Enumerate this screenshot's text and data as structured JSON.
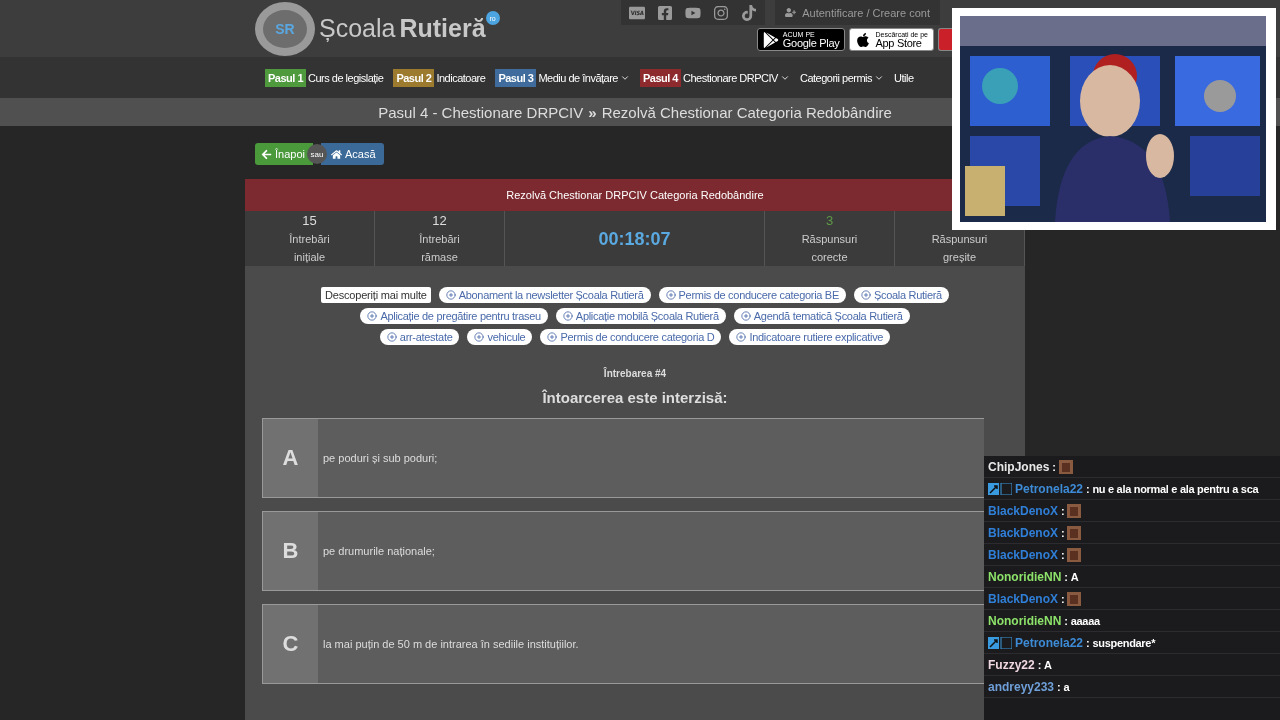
{
  "header": {
    "logo": {
      "mark": "SR",
      "name": "Școala",
      "name_bold": "Rutieră",
      "tld": "ro"
    },
    "login": "Autentificare / Creare cont",
    "stores": [
      {
        "kind": "google",
        "small": "ACUM PE",
        "big": "Google Play"
      },
      {
        "kind": "apple",
        "small": "Descărcați de pe",
        "big": "App Store"
      },
      {
        "kind": "partial"
      }
    ]
  },
  "nav": [
    {
      "step": "Pasul 1",
      "color": "#4f9a3d",
      "label": "Curs de legislație",
      "dropdown": false
    },
    {
      "step": "Pasul 2",
      "color": "#9c7a2e",
      "label": "Indicatoare",
      "dropdown": false
    },
    {
      "step": "Pasul 3",
      "color": "#3f6c9c",
      "label": "Mediu de învățare",
      "dropdown": true
    },
    {
      "step": "Pasul 4",
      "color": "#8c2a2e",
      "label": "Chestionare DRPCIV",
      "dropdown": true
    },
    {
      "label": "Categorii permis",
      "dropdown": true
    },
    {
      "label": "Utile",
      "dropdown": false
    }
  ],
  "breadcrumb": {
    "parent": "Pasul 4 - Chestionare DRPCIV",
    "separator": "»",
    "current": "Rezolvă Chestionar Categoria Redobândire"
  },
  "back_button": "Înapoi",
  "or": "sau",
  "home_button": "Acasă",
  "quiz": {
    "title": "Rezolvă Chestionar DRPCIV Categoria Redobândire",
    "stats": [
      {
        "kind": "count",
        "value": "15",
        "color": "#dddddd",
        "label": [
          "Întrebări",
          "inițiale"
        ]
      },
      {
        "kind": "count",
        "value": "12",
        "color": "#dddddd",
        "label": [
          "Întrebări",
          "rămase"
        ]
      },
      {
        "kind": "timer",
        "value": "00:18:07"
      },
      {
        "kind": "count",
        "value": "3",
        "color": "#5f9a46",
        "label": [
          "Răspunsuri",
          "corecte"
        ]
      },
      {
        "kind": "count",
        "label": [
          "Răspunsuri",
          "greșite"
        ]
      }
    ],
    "discover": "Descoperiți mai multe",
    "tag_rows": [
      [
        "Abonament la newsletter Școala Rutieră",
        "Permis de conducere categoria BE",
        "Școala Rutieră"
      ],
      [
        "Aplicație de pregătire pentru traseu",
        "Aplicație mobilă Școala Rutieră",
        "Agendă tematică Școala Rutieră"
      ],
      [
        "arr-atestate",
        "vehicule",
        "Permis de conducere categoria D",
        "Indicatoare rutiere explicative"
      ]
    ],
    "question_number": "Întrebarea #4",
    "question": "Întoarcerea este interzisă:",
    "answers": [
      {
        "letter": "A",
        "text": "pe poduri și sub poduri;"
      },
      {
        "letter": "B",
        "text": "pe drumurile naționale;"
      },
      {
        "letter": "C",
        "text": "la mai puțin de 50 m de intrarea în sediile instituțiilor."
      }
    ]
  },
  "chat": [
    {
      "user": "ChipJones",
      "color": "#e8e8e8",
      "badges": false,
      "sep": ":",
      "kind": "emote"
    },
    {
      "user": "Petronela22",
      "color": "#3d8bd6",
      "badges": true,
      "sep": ":",
      "kind": "text",
      "text": "nu e ala normal e ala pentru a sca"
    },
    {
      "user": "BlackDenoX",
      "color": "#2f7fd8",
      "badges": false,
      "sep": ":",
      "kind": "emote"
    },
    {
      "user": "BlackDenoX",
      "color": "#2f7fd8",
      "badges": false,
      "sep": ":",
      "kind": "emote"
    },
    {
      "user": "BlackDenoX",
      "color": "#2f7fd8",
      "badges": false,
      "sep": ":",
      "kind": "emote"
    },
    {
      "user": "NonoridieNN",
      "color": "#8de36a",
      "badges": false,
      "sep": ":",
      "kind": "text",
      "text": "A"
    },
    {
      "user": "BlackDenoX",
      "color": "#2f7fd8",
      "badges": false,
      "sep": ":",
      "kind": "emote"
    },
    {
      "user": "NonoridieNN",
      "color": "#8de36a",
      "badges": false,
      "sep": ":",
      "kind": "text",
      "text": "aaaaa"
    },
    {
      "user": "Petronela22",
      "color": "#3d8bd6",
      "badges": true,
      "sep": ":",
      "kind": "text",
      "text": "suspendare*"
    },
    {
      "user": "Fuzzy22",
      "color": "#f0d8e0",
      "badges": false,
      "sep": ":",
      "kind": "text",
      "text": "A"
    },
    {
      "user": "andreyy233",
      "color": "#6f9fd8",
      "badges": false,
      "sep": ":",
      "kind": "text",
      "text": "a"
    }
  ]
}
